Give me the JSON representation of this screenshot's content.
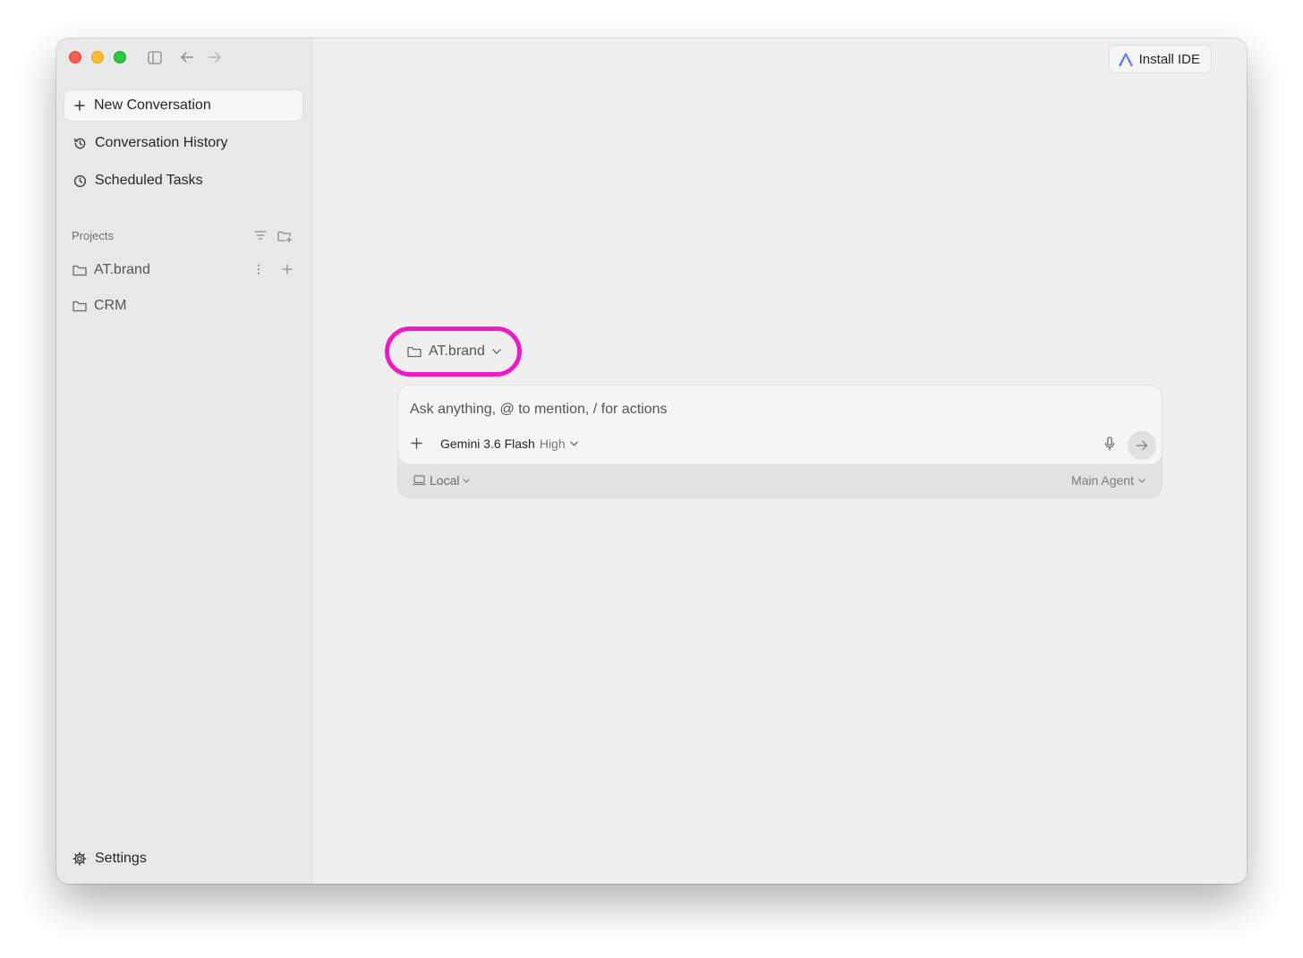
{
  "sidebar": {
    "new_conversation": "New Conversation",
    "conversation_history": "Conversation History",
    "scheduled_tasks": "Scheduled Tasks",
    "projects_label": "Projects",
    "projects": [
      {
        "name": "AT.brand"
      },
      {
        "name": "CRM"
      }
    ],
    "settings": "Settings"
  },
  "header": {
    "install_ide": "Install IDE"
  },
  "composer": {
    "project": "AT.brand",
    "placeholder": "Ask anything, @ to mention, / for actions",
    "model": "Gemini 3.6 Flash",
    "effort": "High",
    "environment": "Local",
    "agent": "Main Agent"
  },
  "icons": {
    "new_conversation": "plus-icon",
    "history": "history-icon",
    "scheduled": "clock-icon",
    "filter": "filter-icon",
    "add_folder": "folder-plus-icon",
    "folder": "folder-icon",
    "more": "kebab-icon",
    "settings": "gear-icon",
    "mic": "mic-icon",
    "send": "arrow-right-icon",
    "laptop": "laptop-icon"
  },
  "colors": {
    "highlight_ring": "#ea1cc6",
    "close": "#fe5f57",
    "minimize": "#febc2e",
    "zoom": "#28c840"
  }
}
